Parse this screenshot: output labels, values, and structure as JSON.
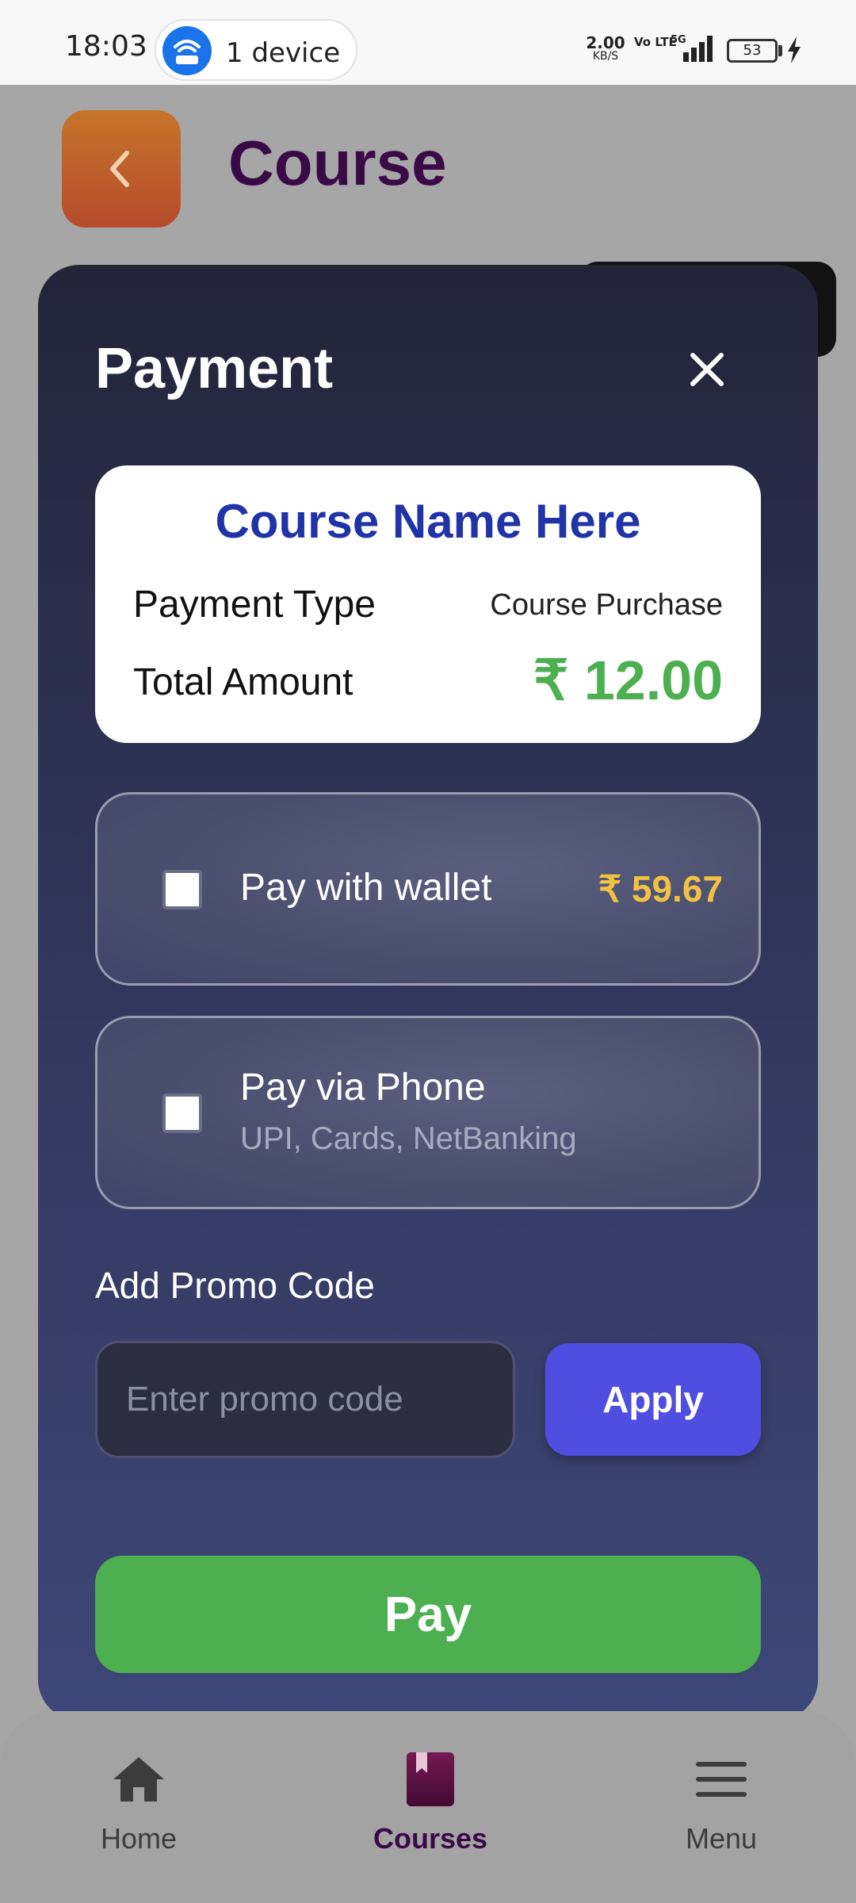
{
  "status_bar": {
    "time": "18:03",
    "hotspot_label": "1 device",
    "hotspot_icon": "wifi-router-icon",
    "net_speed": "2.00",
    "net_speed_unit": "KB/S",
    "volte": "Vo LTE",
    "network": "5G",
    "battery": "53"
  },
  "header": {
    "back_icon": "chevron-left-icon",
    "title": "Course"
  },
  "payment_modal": {
    "title": "Payment",
    "close_icon": "close-icon",
    "summary": {
      "course_name": "Course Name Here",
      "payment_type_label": "Payment Type",
      "payment_type_value": "Course Purchase",
      "total_amount_label": "Total Amount",
      "total_amount_value": "₹ 12.00"
    },
    "options": {
      "wallet": {
        "label": "Pay with wallet",
        "balance": "₹ 59.67",
        "checked": false
      },
      "phone": {
        "label": "Pay via Phone",
        "sublabel": "UPI, Cards, NetBanking",
        "checked": false
      }
    },
    "promo": {
      "label": "Add Promo Code",
      "placeholder": "Enter promo code",
      "value": "",
      "apply_label": "Apply"
    },
    "pay_label": "Pay"
  },
  "bottom_nav": {
    "items": [
      {
        "label": "Home",
        "icon": "home-icon",
        "active": false
      },
      {
        "label": "Courses",
        "icon": "book-icon",
        "active": true
      },
      {
        "label": "Menu",
        "icon": "menu-icon",
        "active": false
      }
    ]
  },
  "colors": {
    "accent_green": "#4caf50",
    "accent_blue": "#4f4ee0",
    "course_title": "#2034a8",
    "wallet_balance": "#f3c242",
    "page_title": "#3a0a47",
    "modal_bg_top": "#232438",
    "modal_bg_bottom": "#3d4678"
  }
}
